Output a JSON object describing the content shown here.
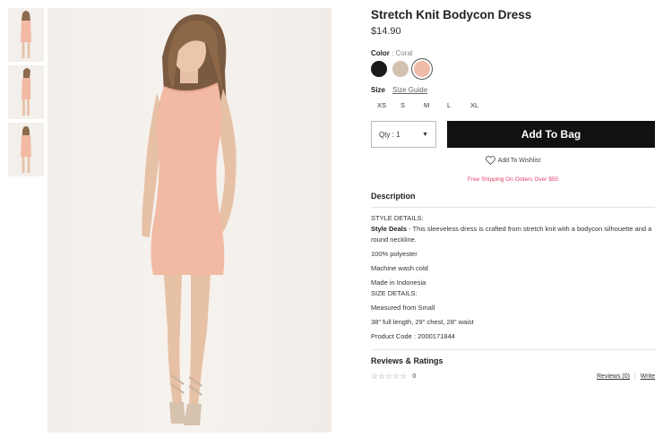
{
  "product": {
    "title": "Stretch Knit Bodycon Dress",
    "price": "$14.90",
    "image_color": "#f2b9a3"
  },
  "color": {
    "label": "Color",
    "selected_value": ": Coral",
    "swatches": [
      {
        "name": "black",
        "hex": "#1a1a1a"
      },
      {
        "name": "taupe",
        "hex": "#d4c2b0"
      },
      {
        "name": "coral",
        "hex": "#f0bba8"
      }
    ]
  },
  "size": {
    "label": "Size",
    "guide_label": "Size Guide",
    "options": [
      "XS",
      "S",
      "M",
      "L",
      "XL"
    ]
  },
  "purchase": {
    "qty_label": "Qty : 1",
    "qty_arrow": "▼",
    "add_to_bag": "Add To Bag",
    "wishlist": "Add To Wishlist",
    "shipping": "Free Shipping On Orders Over $50"
  },
  "description": {
    "heading": "Description",
    "style_details_heading": "STYLE DETAILS:",
    "style_deals_label": "Style Deals",
    "style_deals_text": " - This sleeveless dress is crafted from stretch knit with a bodycon silhouette and a round neckline.",
    "material": "100% polyester",
    "care": "Machine wash cold",
    "origin": "Made in Indonesia",
    "size_details_heading": "SIZE DETAILS:",
    "measured": "Measured from Small",
    "measurements": "38\" full length, 29\" chest, 28\" waist",
    "product_code": "Product Code : 2000171844"
  },
  "reviews": {
    "heading": "Reviews & Ratings",
    "stars": "☆☆☆☆☆",
    "count": "0",
    "reviews_link": "Reviews (0)",
    "separator": "|",
    "write_link": "Write"
  }
}
